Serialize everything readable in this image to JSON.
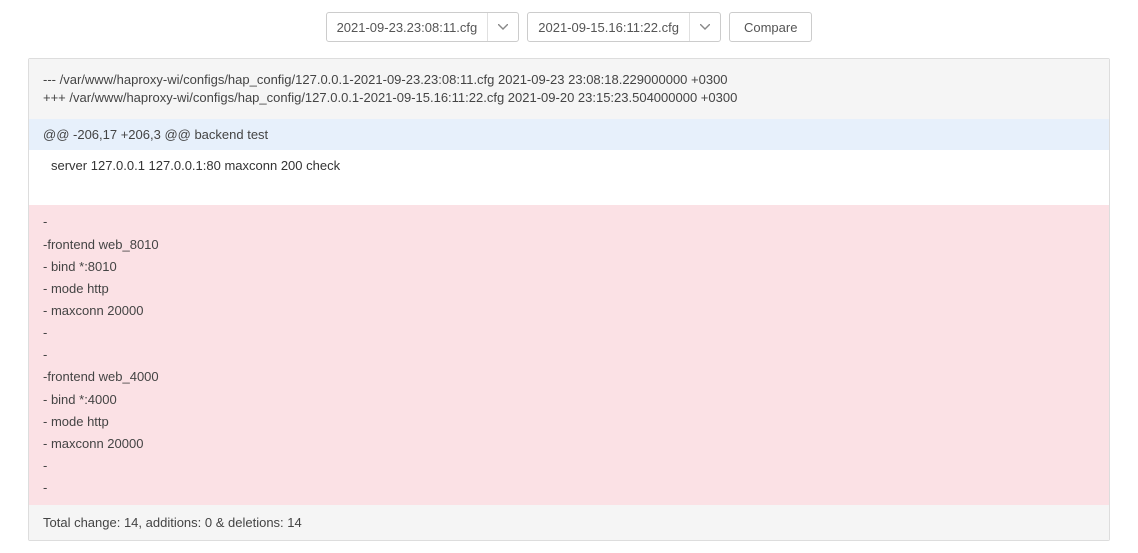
{
  "controls": {
    "select_a": "2021-09-23.23:08:11.cfg",
    "select_b": "2021-09-15.16:11:22.cfg",
    "compare_label": "Compare"
  },
  "diff_header": {
    "old_line": "--- /var/www/haproxy-wi/configs/hap_config/127.0.0.1-2021-09-23.23:08:11.cfg 2021-09-23 23:08:18.229000000 +0300",
    "new_line": "+++ /var/www/haproxy-wi/configs/hap_config/127.0.0.1-2021-09-15.16:11:22.cfg 2021-09-20 23:15:23.504000000 +0300"
  },
  "hunk": "@@ -206,17 +206,3 @@ backend test",
  "context": "server 127.0.0.1 127.0.0.1:80 maxconn 200 check",
  "removed": [
    "-",
    "-frontend web_8010",
    "- bind *:8010",
    "- mode http",
    "- maxconn 20000",
    "-",
    "-",
    "-frontend web_4000",
    "- bind *:4000",
    "- mode http",
    "- maxconn 20000",
    "-",
    "-"
  ],
  "summary": "Total change: 14, additions: 0 & deletions: 14"
}
